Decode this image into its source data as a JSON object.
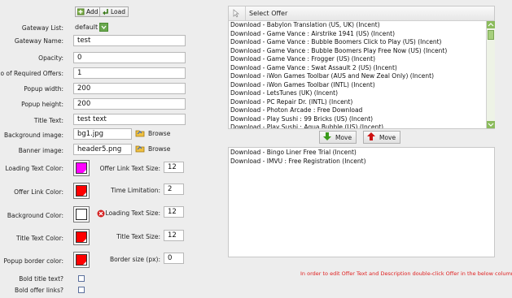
{
  "toolbar": {
    "add_label": "Add",
    "load_label": "Load"
  },
  "form": {
    "gateway_list": {
      "label": "Gateway List:",
      "value": "default"
    },
    "gateway_name": {
      "label": "Gateway Name:",
      "value": "test"
    },
    "opacity": {
      "label": "Opacity:",
      "value": "0"
    },
    "required_offers": {
      "label": "No of Required Offers:",
      "value": "1"
    },
    "popup_width": {
      "label": "Popup width:",
      "value": "200"
    },
    "popup_height": {
      "label": "Popup height:",
      "value": "200"
    },
    "title_text": {
      "label": "Title Text:",
      "value": "test text"
    },
    "background_image": {
      "label": "Background image:",
      "value": "bg1.jpg",
      "browse": "Browse"
    },
    "banner_image": {
      "label": "Banner image:",
      "value": "header5.png",
      "browse": "Browse"
    },
    "loading_text_color": {
      "label": "Loading Text Color:",
      "color": "#ff00ff"
    },
    "offer_link_color": {
      "label": "Offer Link Color:",
      "color": "#ff0000"
    },
    "background_color": {
      "label": "Background Color:",
      "color": "#ffffff"
    },
    "title_text_color": {
      "label": "Title Text Color:",
      "color": "#ff0000"
    },
    "popup_border_color": {
      "label": "Popup border color:",
      "color": "#ff0000"
    },
    "offer_link_text_size": {
      "label": "Offer Link Text Size:",
      "value": "12"
    },
    "time_limitation": {
      "label": "Time Limitation:",
      "value": "2"
    },
    "loading_text_size": {
      "label": "Loading Text Size:",
      "value": "12"
    },
    "title_text_size": {
      "label": "Title Text Size:",
      "value": "12"
    },
    "border_size": {
      "label": "Border size (px):",
      "value": "0"
    },
    "bold_title_text": {
      "label": "Bold title text?"
    },
    "bold_offer_links": {
      "label": "Bold offer links?"
    }
  },
  "offers_panel": {
    "header": "Select Offer",
    "available": [
      "Download - Babylon Translation (US, UK) (Incent)",
      "Download - Game Vance : Airstrike 1941 (US) (Incent)",
      "Download - Game Vance : Bubble Boomers Click to Play (US) (Incent)",
      "Download - Game Vance : Bubble Boomers Play Free Now (US) (Incent)",
      "Download - Game Vance : Frogger (US) (Incent)",
      "Download - Game Vance : Swat Assault 2 (US) (Incent)",
      "Download - iWon Games Toolbar (AUS and New Zeal Only) (Incent)",
      "Download - iWon Games Toolbar (INTL) (Incent)",
      "Download - LetsTunes (UK) (Incent)",
      "Download - PC Repair Dr. (INTL) (Incent)",
      "Download - Photon Arcade : Free Download",
      "Download - Play Sushi : 99 Bricks (US) (Incent)",
      "Download - Play Sushi : Aqua Bubble (US) (Incent)"
    ],
    "move_down_label": "Move",
    "move_up_label": "Move",
    "selected": [
      "Download - Bingo Liner Free Trial (Incent)",
      "Download - IMVU : Free Registration (Incent)"
    ],
    "hint": "In order to edit Offer Text and Description double-click Offer in the below column."
  },
  "colors": {
    "hint_red": "#e02020",
    "accent_green": "#3a9a1a",
    "accent_red": "#cc1111"
  }
}
